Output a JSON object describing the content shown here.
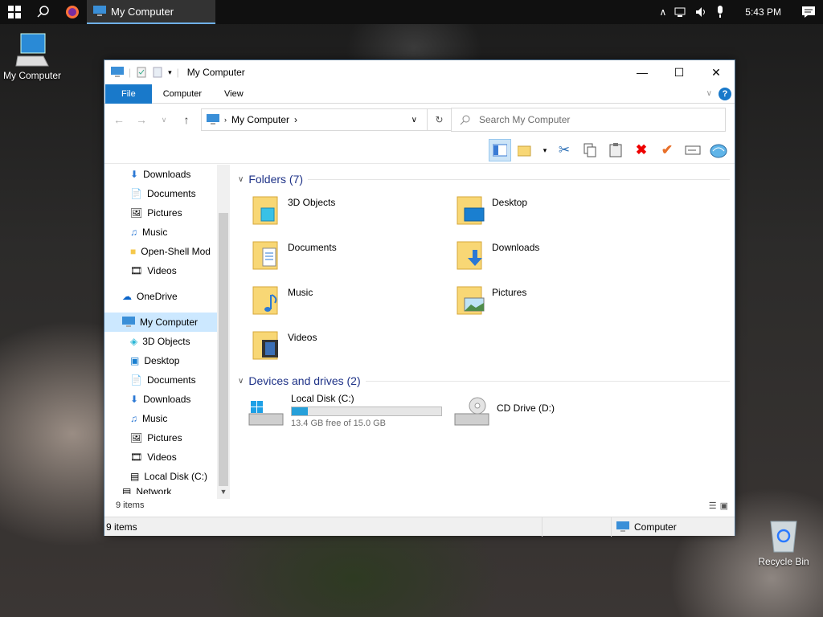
{
  "taskbar": {
    "app_title": "My Computer",
    "clock": "5:43 PM"
  },
  "desktop": {
    "my_computer_label": "My Computer",
    "recycle_bin_label": "Recycle Bin"
  },
  "window": {
    "title": "My Computer",
    "tabs": [
      "File",
      "Computer",
      "View"
    ],
    "address": "My Computer",
    "search_placeholder": "Search My Computer"
  },
  "nav": {
    "quick": [
      {
        "label": "Downloads"
      },
      {
        "label": "Documents"
      },
      {
        "label": "Pictures"
      },
      {
        "label": "Music"
      },
      {
        "label": "Open-Shell Mod"
      },
      {
        "label": "Videos"
      }
    ],
    "onedrive": "OneDrive",
    "mycomputer": "My Computer",
    "pc_items": [
      {
        "label": "3D Objects"
      },
      {
        "label": "Desktop"
      },
      {
        "label": "Documents"
      },
      {
        "label": "Downloads"
      },
      {
        "label": "Music"
      },
      {
        "label": "Pictures"
      },
      {
        "label": "Videos"
      },
      {
        "label": "Local Disk (C:)"
      }
    ],
    "network": "Network"
  },
  "content": {
    "folders_header": "Folders (7)",
    "folders": [
      "3D Objects",
      "Desktop",
      "Documents",
      "Downloads",
      "Music",
      "Pictures",
      "Videos"
    ],
    "devices_header": "Devices and drives (2)",
    "drive_c": {
      "name": "Local Disk (C:)",
      "free_text": "13.4 GB free of 15.0 GB",
      "used_fraction": 0.107
    },
    "drive_d": {
      "name": "CD Drive (D:)"
    }
  },
  "status": {
    "items_count": "9 items",
    "bar_items": "9 items",
    "bar_location": "Computer"
  }
}
